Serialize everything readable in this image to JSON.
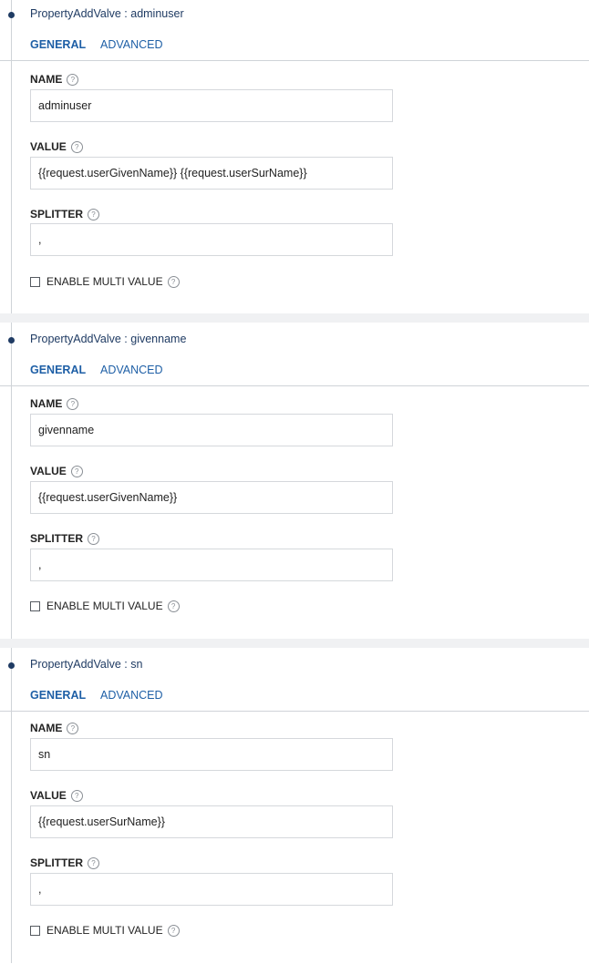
{
  "labels": {
    "tab_general": "GENERAL",
    "tab_advanced": "ADVANCED",
    "name": "NAME",
    "value": "VALUE",
    "splitter": "SPLITTER",
    "enable_multi_value": "ENABLE MULTI VALUE",
    "help_glyph": "?"
  },
  "valves": [
    {
      "title": "PropertyAddValve : adminuser",
      "name": "adminuser",
      "value": "{{request.userGivenName}} {{request.userSurName}}",
      "splitter": ",",
      "multi_value": false
    },
    {
      "title": "PropertyAddValve : givenname",
      "name": "givenname",
      "value": "{{request.userGivenName}}",
      "splitter": ",",
      "multi_value": false
    },
    {
      "title": "PropertyAddValve : sn",
      "name": "sn",
      "value": "{{request.userSurName}}",
      "splitter": ",",
      "multi_value": false
    }
  ],
  "colors": {
    "title_text": "#1f3b63",
    "tab_accent": "#1e5fa6",
    "divider": "#cfd3d8",
    "separator_band": "#f0f1f3"
  },
  "icons": {
    "field_help": "help-circle-icon",
    "timeline_marker": "timeline-dot-icon",
    "checkbox": "checkbox-unchecked-icon"
  }
}
